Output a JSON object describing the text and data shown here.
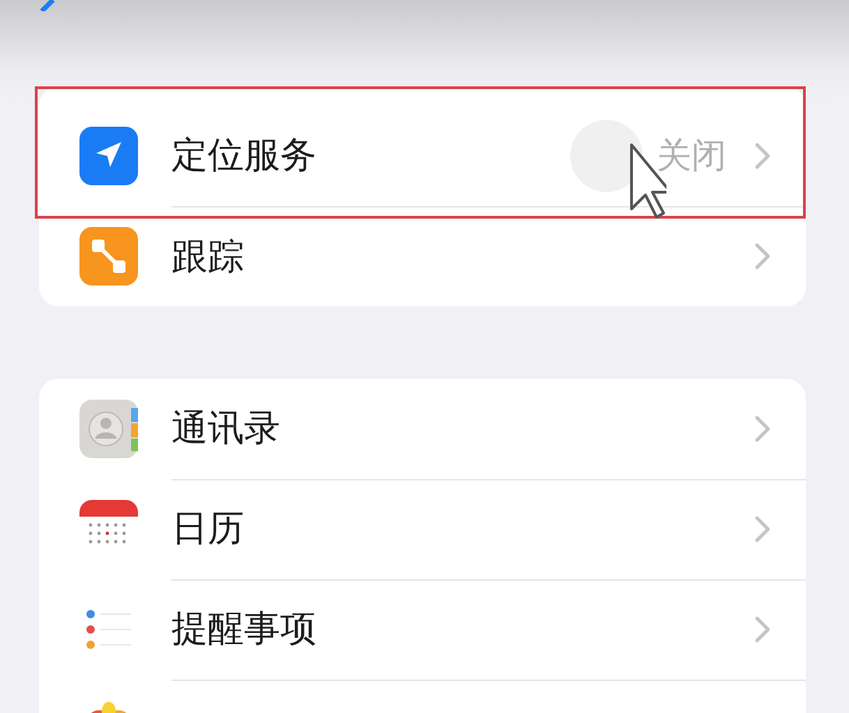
{
  "groups": [
    {
      "rows": [
        {
          "kind": "location",
          "label": "定位服务",
          "value": "关闭",
          "highlighted": true,
          "pointer": true
        },
        {
          "kind": "tracking",
          "label": "跟踪"
        }
      ]
    },
    {
      "rows": [
        {
          "kind": "contacts",
          "label": "通讯录"
        },
        {
          "kind": "calendar",
          "label": "日历"
        },
        {
          "kind": "reminders",
          "label": "提醒事项"
        },
        {
          "kind": "photos"
        }
      ]
    }
  ]
}
